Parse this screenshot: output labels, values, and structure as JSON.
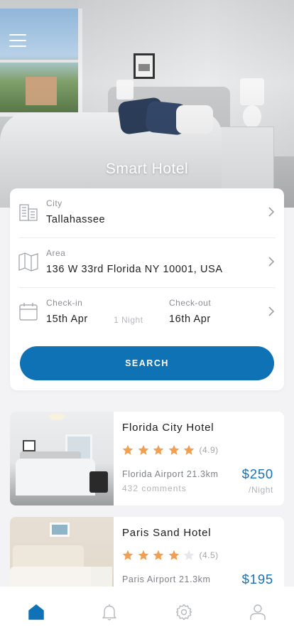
{
  "hero": {
    "title": "Smart Hotel",
    "menu_icon": "hamburger-menu-icon"
  },
  "search": {
    "city": {
      "label": "City",
      "value": "Tallahassee",
      "icon": "building-icon"
    },
    "area": {
      "label": "Area",
      "value": "136 W 33rd Florida NY 10001, USA",
      "icon": "map-icon"
    },
    "checkin": {
      "label": "Check-in",
      "value": "15th Apr",
      "icon": "calendar-icon"
    },
    "nights": "1 Night",
    "checkout": {
      "label": "Check-out",
      "value": "16th Apr"
    },
    "button_label": "SEARCH"
  },
  "hotels": [
    {
      "name": "Florida City Hotel",
      "stars": 5,
      "rating_text": "(4.9)",
      "location": "Florida Airport 21.3km",
      "comments": "432 comments",
      "price": "$250",
      "per": "/Night"
    },
    {
      "name": "Paris Sand Hotel",
      "stars": 4,
      "rating_text": "(4.5)",
      "location": "Paris Airport 21.3km",
      "price": "$195"
    }
  ],
  "tabbar": {
    "items": [
      "home-icon",
      "bell-icon",
      "gear-icon",
      "user-icon"
    ],
    "active": "home-icon"
  },
  "colors": {
    "accent": "#0f72b4",
    "price": "#1573b6",
    "star_filled": "#f0a050",
    "star_empty": "#e6e8ec",
    "background": "#f3f3f5"
  }
}
